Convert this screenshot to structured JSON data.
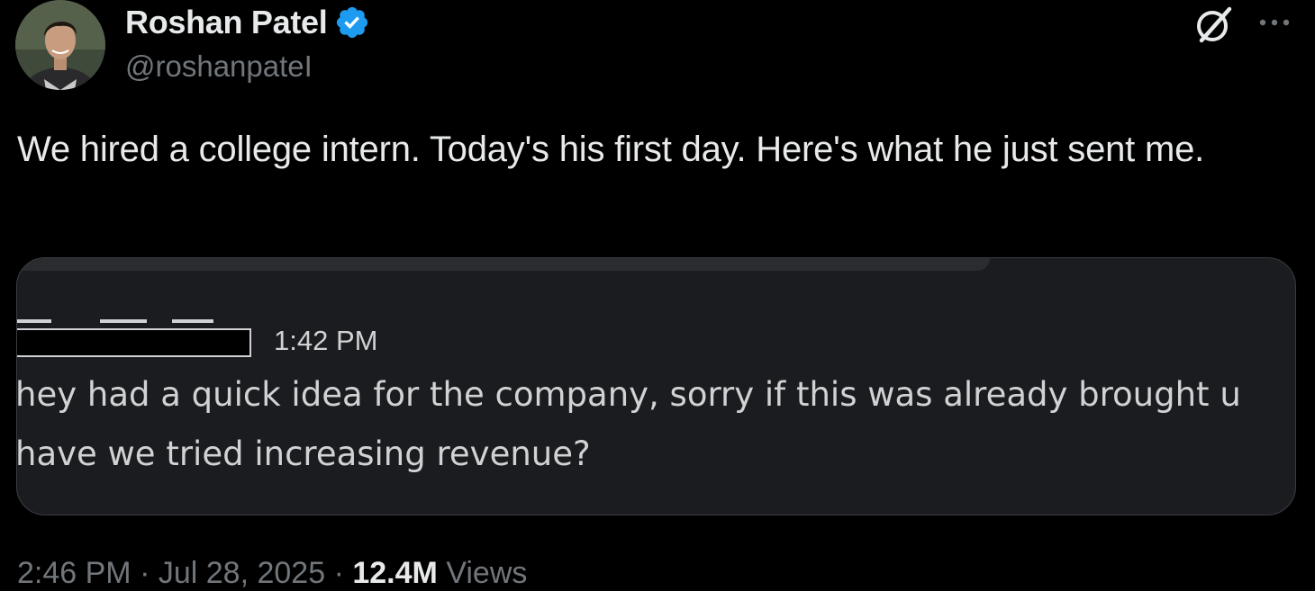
{
  "author": {
    "display_name": "Roshan Patel",
    "handle": "@roshanpateI",
    "verified": true,
    "verified_color": "#1d9bf0",
    "avatar_icon": "profile-photo"
  },
  "header_actions": {
    "grok_icon": "grok-icon",
    "more_icon": "more-horizontal-icon"
  },
  "tweet": {
    "text": "We hired a college intern. Today's his first day. Here's what he just sent me."
  },
  "embedded_message": {
    "sender_redacted": true,
    "time": "1:42 PM",
    "line1": "hey had a quick idea for the company, sorry if this was already brought u",
    "line2": "have we tried increasing revenue?"
  },
  "meta": {
    "time": "2:46 PM",
    "separator": "·",
    "date": "Jul 28, 2025",
    "views_count": "12.4M",
    "views_label": "Views"
  },
  "colors": {
    "background": "#000000",
    "text_primary": "#e7e9ea",
    "text_secondary": "#71767b",
    "media_bg": "#1b1c1f"
  }
}
